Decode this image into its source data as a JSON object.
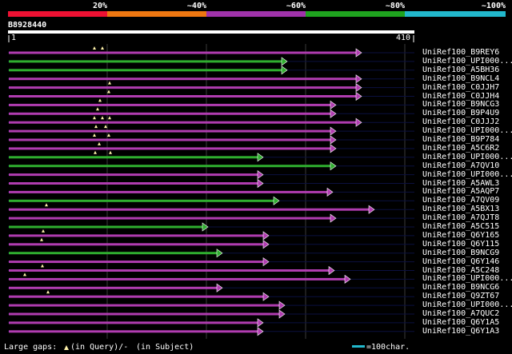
{
  "scale": {
    "segments": [
      {
        "label": "20%",
        "color": "#ee1133"
      },
      {
        "label": "~40%",
        "color": "#ee7711"
      },
      {
        "label": "~60%",
        "color": "#a033aa"
      },
      {
        "label": "~80%",
        "color": "#1fa31f"
      },
      {
        "label": "~100%",
        "color": "#22b8cc"
      }
    ]
  },
  "query": {
    "id": "B8928440",
    "start": "1",
    "end": "410"
  },
  "hits": [
    {
      "name": "UniRef100_B9REY6",
      "color": "#b03cb0"
    },
    {
      "name": "UniRef100_UPI000...",
      "color": "#2fae2f"
    },
    {
      "name": "UniRef100_A5BH36",
      "color": "#2fae2f"
    },
    {
      "name": "UniRef100_B9NCL4",
      "color": "#b03cb0"
    },
    {
      "name": "UniRef100_C0JJH7",
      "color": "#b03cb0"
    },
    {
      "name": "UniRef100_C0JJH4",
      "color": "#b03cb0"
    },
    {
      "name": "UniRef100_B9NCG3",
      "color": "#b03cb0"
    },
    {
      "name": "UniRef100_B9P4U9",
      "color": "#b03cb0"
    },
    {
      "name": "UniRef100_C0JJJ2",
      "color": "#b03cb0"
    },
    {
      "name": "UniRef100_UPI000...",
      "color": "#b03cb0"
    },
    {
      "name": "UniRef100_B9P784",
      "color": "#b03cb0"
    },
    {
      "name": "UniRef100_A5C6R2",
      "color": "#b03cb0"
    },
    {
      "name": "UniRef100_UPI000...",
      "color": "#2fae2f"
    },
    {
      "name": "UniRef100_A7QV10",
      "color": "#2fae2f"
    },
    {
      "name": "UniRef100_UPI000...",
      "color": "#b03cb0"
    },
    {
      "name": "UniRef100_A5AWL3",
      "color": "#b03cb0"
    },
    {
      "name": "UniRef100_A5AQP7",
      "color": "#b03cb0"
    },
    {
      "name": "UniRef100_A7QV09",
      "color": "#2fae2f"
    },
    {
      "name": "UniRef100_A5BX13",
      "color": "#b03cb0"
    },
    {
      "name": "UniRef100_A7QJT8",
      "color": "#b03cb0"
    },
    {
      "name": "UniRef100_A5C515",
      "color": "#2fae2f"
    },
    {
      "name": "UniRef100_Q6Y165",
      "color": "#b03cb0"
    },
    {
      "name": "UniRef100_Q6Y115",
      "color": "#b03cb0"
    },
    {
      "name": "UniRef100_B9NCG9",
      "color": "#2fae2f"
    },
    {
      "name": "UniRef100_Q6Y146",
      "color": "#b03cb0"
    },
    {
      "name": "UniRef100_A5C248",
      "color": "#b03cb0"
    },
    {
      "name": "UniRef100_UPI000...",
      "color": "#b03cb0"
    },
    {
      "name": "UniRef100_B9NCG6",
      "color": "#b03cb0"
    },
    {
      "name": "UniRef100_Q9ZT67",
      "color": "#b03cb0"
    },
    {
      "name": "UniRef100_UPI000...",
      "color": "#b03cb0"
    },
    {
      "name": "UniRef100_A7QUC2",
      "color": "#b03cb0"
    },
    {
      "name": "UniRef100_Q6Y1A5",
      "color": "#b03cb0"
    },
    {
      "name": "UniRef100_Q6Y1A3",
      "color": "#b03cb0"
    }
  ],
  "footer": {
    "legend_prefix": "Large gaps:",
    "legend_query": "(in Query)/-",
    "legend_subject": "(in Subject)",
    "scale_note": "=100char.",
    "scale_color": "#22b8cc"
  }
}
